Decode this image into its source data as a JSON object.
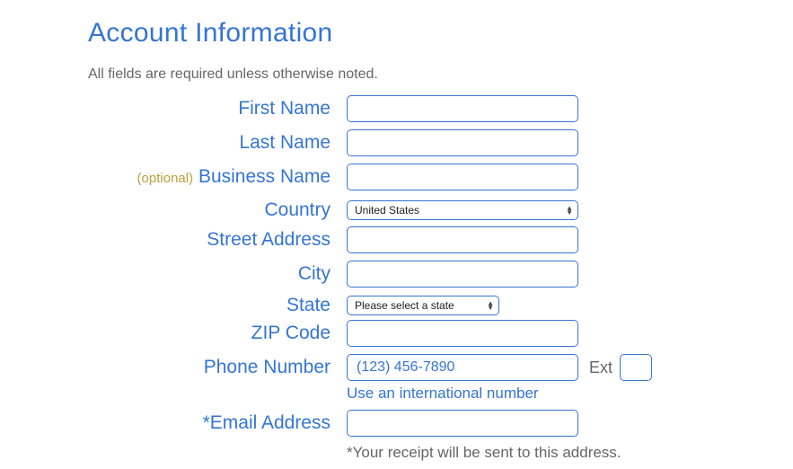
{
  "heading": "Account Information",
  "subtitle": "All fields are required unless otherwise noted.",
  "optional_tag": "(optional)",
  "labels": {
    "first_name": "First Name",
    "last_name": "Last Name",
    "business_name": "Business Name",
    "country": "Country",
    "street_address": "Street Address",
    "city": "City",
    "state": "State",
    "zip": "ZIP Code",
    "phone": "Phone Number",
    "ext": "Ext",
    "email": "*Email Address"
  },
  "values": {
    "first_name": "",
    "last_name": "",
    "business_name": "",
    "country": "United States",
    "street_address": "",
    "city": "",
    "state": "Please select a state",
    "zip": "",
    "phone": "",
    "ext": "",
    "email": ""
  },
  "placeholders": {
    "phone": "(123) 456-7890"
  },
  "helper": {
    "intl_number": "Use an international number",
    "receipt_note": "*Your receipt will be sent to this address."
  }
}
